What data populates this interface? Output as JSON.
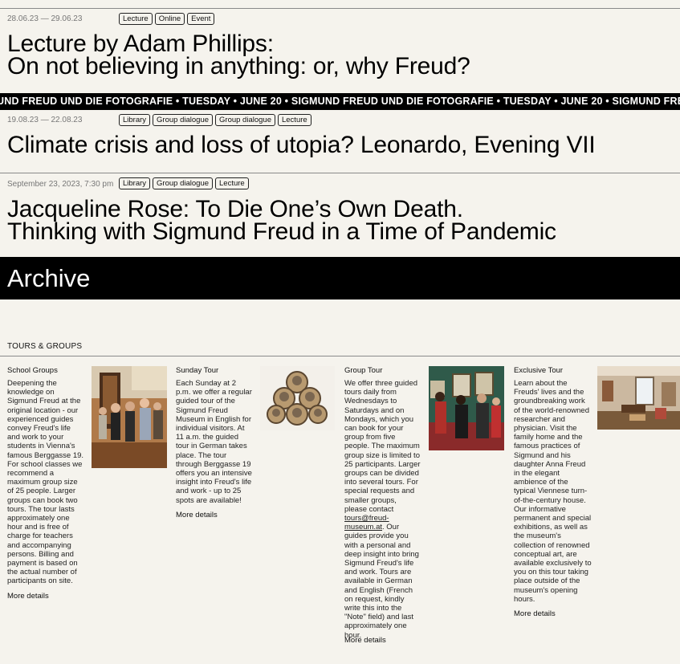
{
  "events": [
    {
      "date": "28.06.23 — 29.06.23",
      "tags": [
        "Lecture",
        "Online",
        "Event"
      ],
      "title_lines": [
        "Lecture by Adam Phillips:",
        "On not believing in anything: or, why Freud?"
      ]
    },
    {
      "date": "19.08.23 — 22.08.23",
      "tags": [
        "Library",
        "Group dialogue",
        "Group dialogue",
        "Lecture"
      ],
      "title_lines": [
        "Climate crisis and loss of utopia? Leonardo, Evening VII"
      ]
    },
    {
      "date": "September 23, 2023, 7:30 pm",
      "tags": [
        "Library",
        "Group dialogue",
        "Lecture"
      ],
      "title_lines": [
        "Jacqueline Rose: To Die One’s Own Death.",
        "Thinking with Sigmund Freud in a Time of Pandemic"
      ]
    }
  ],
  "ticker": {
    "text": "UND FREUD UND DIE FOTOGRAFIE  •  TUESDAY  •  JUNE 20  •  SIGMUND FREUD UND DIE FOTOGRAFIE  •  TUESDAY  •  JUNE 20  •  SIGMUND FREUD UND DIE FOTOGRAFIE"
  },
  "archive": {
    "label": "Archive"
  },
  "section": {
    "heading": "TOURS & GROUPS"
  },
  "cards": [
    {
      "title": "School Groups",
      "body": "Deepening the knowledge on Sigmund Freud at the original location - our experienced guides convey Freud's life and work to your students in Vienna's famous Berggasse 19. For school classes we recommend a maximum group size of 25 people. Larger groups can book two tours. The tour lasts approximately one hour and is free of charge for teachers and accompanying persons. Billing and payment is based on the actual number of participants on site.",
      "more": "More details"
    },
    {
      "title": "Sunday Tour",
      "body": "Each Sunday at 2 p.m. we offer a regular guided tour of the Sigmund Freud Museum in English for individual visitors. At 11 a.m. the guided tour in German takes place. The tour through Berggasse 19 offers you an intensive insight into Freud's life and work - up to 25 spots are available!",
      "more": "More details"
    },
    {
      "title": "Group Tour",
      "body_before": "We offer three guided tours daily from Wednesdays to Saturdays and on Mondays, which you can book for your group from five people. The maximum group size is limited to 25 participants. Larger groups can be divided into several tours. For special requests and smaller groups, please contact ",
      "link": "tours@freud-museum.at",
      "body_after": ". Our guides provide you with a personal and deep insight into bring Sigmund Freud's life and work. Tours are available in German and English (French on request, kindly write this into the \"Note\" field) and last approximately one hour.",
      "more": "More details"
    },
    {
      "title": "Exclusive Tour",
      "body": "Learn about the Freuds' lives and the groundbreaking work of the world-renowned researcher and physician. Visit the family home and the famous practices of Sigmund and his daughter Anna Freud in the elegant ambience of the typical Viennese turn-of-the-century house. Our informative permanent and special exhibitions, as well as the museum's collection of renowned conceptual art, are available exclusively to you on this tour taking place outside of the museum's opening hours.",
      "more": "More details"
    }
  ]
}
